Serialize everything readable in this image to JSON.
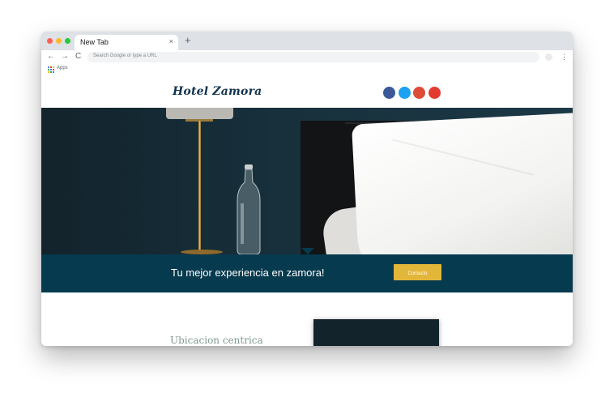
{
  "browser": {
    "tab_title": "New Tab",
    "tab_close": "×",
    "new_tab": "+",
    "back_icon": "←",
    "forward_icon": "→",
    "reload_icon": "C",
    "omnibox_placeholder": "Search Google or type a URL",
    "menu_icon": "⋮",
    "bookmarks": {
      "apps_label": "Apps"
    }
  },
  "site": {
    "logo": "Hotel Zamora",
    "social": [
      {
        "name": "facebook",
        "icon": "",
        "color": "#3b5998"
      },
      {
        "name": "twitter",
        "icon": "",
        "color": "#1da1f2"
      },
      {
        "name": "google-plus",
        "icon": "",
        "color": "#dd4b39"
      },
      {
        "name": "pinterest",
        "icon": "",
        "color": "#e33b2f"
      }
    ],
    "banner": {
      "text": "Tu mejor experiencia en zamora!",
      "button_label": "Contacto ",
      "color": "#063a4f",
      "button_color": "#e2b639"
    },
    "feature": {
      "title": "Ubicacion centrica"
    }
  }
}
